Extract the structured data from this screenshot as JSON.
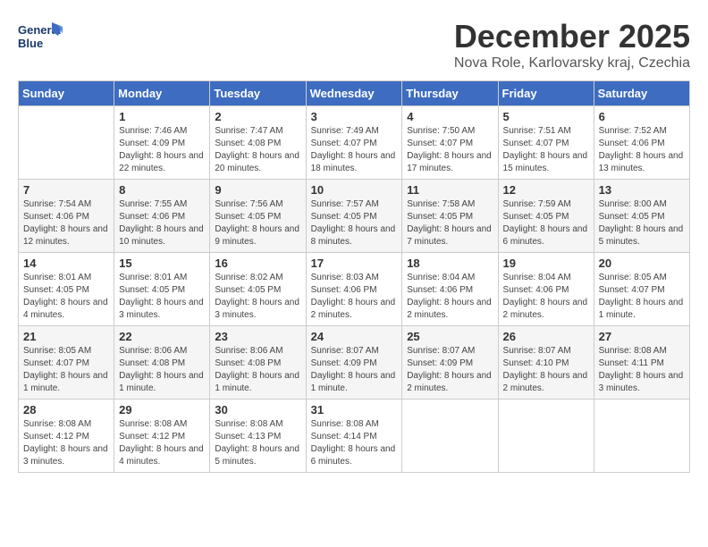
{
  "header": {
    "logo_text_top": "General",
    "logo_text_bottom": "Blue",
    "month": "December 2025",
    "location": "Nova Role, Karlovarsky kraj, Czechia"
  },
  "days_of_week": [
    "Sunday",
    "Monday",
    "Tuesday",
    "Wednesday",
    "Thursday",
    "Friday",
    "Saturday"
  ],
  "weeks": [
    [
      {
        "day": "",
        "sunrise": "",
        "sunset": "",
        "daylight": ""
      },
      {
        "day": "1",
        "sunrise": "Sunrise: 7:46 AM",
        "sunset": "Sunset: 4:09 PM",
        "daylight": "Daylight: 8 hours and 22 minutes."
      },
      {
        "day": "2",
        "sunrise": "Sunrise: 7:47 AM",
        "sunset": "Sunset: 4:08 PM",
        "daylight": "Daylight: 8 hours and 20 minutes."
      },
      {
        "day": "3",
        "sunrise": "Sunrise: 7:49 AM",
        "sunset": "Sunset: 4:07 PM",
        "daylight": "Daylight: 8 hours and 18 minutes."
      },
      {
        "day": "4",
        "sunrise": "Sunrise: 7:50 AM",
        "sunset": "Sunset: 4:07 PM",
        "daylight": "Daylight: 8 hours and 17 minutes."
      },
      {
        "day": "5",
        "sunrise": "Sunrise: 7:51 AM",
        "sunset": "Sunset: 4:07 PM",
        "daylight": "Daylight: 8 hours and 15 minutes."
      },
      {
        "day": "6",
        "sunrise": "Sunrise: 7:52 AM",
        "sunset": "Sunset: 4:06 PM",
        "daylight": "Daylight: 8 hours and 13 minutes."
      }
    ],
    [
      {
        "day": "7",
        "sunrise": "Sunrise: 7:54 AM",
        "sunset": "Sunset: 4:06 PM",
        "daylight": "Daylight: 8 hours and 12 minutes."
      },
      {
        "day": "8",
        "sunrise": "Sunrise: 7:55 AM",
        "sunset": "Sunset: 4:06 PM",
        "daylight": "Daylight: 8 hours and 10 minutes."
      },
      {
        "day": "9",
        "sunrise": "Sunrise: 7:56 AM",
        "sunset": "Sunset: 4:05 PM",
        "daylight": "Daylight: 8 hours and 9 minutes."
      },
      {
        "day": "10",
        "sunrise": "Sunrise: 7:57 AM",
        "sunset": "Sunset: 4:05 PM",
        "daylight": "Daylight: 8 hours and 8 minutes."
      },
      {
        "day": "11",
        "sunrise": "Sunrise: 7:58 AM",
        "sunset": "Sunset: 4:05 PM",
        "daylight": "Daylight: 8 hours and 7 minutes."
      },
      {
        "day": "12",
        "sunrise": "Sunrise: 7:59 AM",
        "sunset": "Sunset: 4:05 PM",
        "daylight": "Daylight: 8 hours and 6 minutes."
      },
      {
        "day": "13",
        "sunrise": "Sunrise: 8:00 AM",
        "sunset": "Sunset: 4:05 PM",
        "daylight": "Daylight: 8 hours and 5 minutes."
      }
    ],
    [
      {
        "day": "14",
        "sunrise": "Sunrise: 8:01 AM",
        "sunset": "Sunset: 4:05 PM",
        "daylight": "Daylight: 8 hours and 4 minutes."
      },
      {
        "day": "15",
        "sunrise": "Sunrise: 8:01 AM",
        "sunset": "Sunset: 4:05 PM",
        "daylight": "Daylight: 8 hours and 3 minutes."
      },
      {
        "day": "16",
        "sunrise": "Sunrise: 8:02 AM",
        "sunset": "Sunset: 4:05 PM",
        "daylight": "Daylight: 8 hours and 3 minutes."
      },
      {
        "day": "17",
        "sunrise": "Sunrise: 8:03 AM",
        "sunset": "Sunset: 4:06 PM",
        "daylight": "Daylight: 8 hours and 2 minutes."
      },
      {
        "day": "18",
        "sunrise": "Sunrise: 8:04 AM",
        "sunset": "Sunset: 4:06 PM",
        "daylight": "Daylight: 8 hours and 2 minutes."
      },
      {
        "day": "19",
        "sunrise": "Sunrise: 8:04 AM",
        "sunset": "Sunset: 4:06 PM",
        "daylight": "Daylight: 8 hours and 2 minutes."
      },
      {
        "day": "20",
        "sunrise": "Sunrise: 8:05 AM",
        "sunset": "Sunset: 4:07 PM",
        "daylight": "Daylight: 8 hours and 1 minute."
      }
    ],
    [
      {
        "day": "21",
        "sunrise": "Sunrise: 8:05 AM",
        "sunset": "Sunset: 4:07 PM",
        "daylight": "Daylight: 8 hours and 1 minute."
      },
      {
        "day": "22",
        "sunrise": "Sunrise: 8:06 AM",
        "sunset": "Sunset: 4:08 PM",
        "daylight": "Daylight: 8 hours and 1 minute."
      },
      {
        "day": "23",
        "sunrise": "Sunrise: 8:06 AM",
        "sunset": "Sunset: 4:08 PM",
        "daylight": "Daylight: 8 hours and 1 minute."
      },
      {
        "day": "24",
        "sunrise": "Sunrise: 8:07 AM",
        "sunset": "Sunset: 4:09 PM",
        "daylight": "Daylight: 8 hours and 1 minute."
      },
      {
        "day": "25",
        "sunrise": "Sunrise: 8:07 AM",
        "sunset": "Sunset: 4:09 PM",
        "daylight": "Daylight: 8 hours and 2 minutes."
      },
      {
        "day": "26",
        "sunrise": "Sunrise: 8:07 AM",
        "sunset": "Sunset: 4:10 PM",
        "daylight": "Daylight: 8 hours and 2 minutes."
      },
      {
        "day": "27",
        "sunrise": "Sunrise: 8:08 AM",
        "sunset": "Sunset: 4:11 PM",
        "daylight": "Daylight: 8 hours and 3 minutes."
      }
    ],
    [
      {
        "day": "28",
        "sunrise": "Sunrise: 8:08 AM",
        "sunset": "Sunset: 4:12 PM",
        "daylight": "Daylight: 8 hours and 3 minutes."
      },
      {
        "day": "29",
        "sunrise": "Sunrise: 8:08 AM",
        "sunset": "Sunset: 4:12 PM",
        "daylight": "Daylight: 8 hours and 4 minutes."
      },
      {
        "day": "30",
        "sunrise": "Sunrise: 8:08 AM",
        "sunset": "Sunset: 4:13 PM",
        "daylight": "Daylight: 8 hours and 5 minutes."
      },
      {
        "day": "31",
        "sunrise": "Sunrise: 8:08 AM",
        "sunset": "Sunset: 4:14 PM",
        "daylight": "Daylight: 8 hours and 6 minutes."
      },
      {
        "day": "",
        "sunrise": "",
        "sunset": "",
        "daylight": ""
      },
      {
        "day": "",
        "sunrise": "",
        "sunset": "",
        "daylight": ""
      },
      {
        "day": "",
        "sunrise": "",
        "sunset": "",
        "daylight": ""
      }
    ]
  ]
}
